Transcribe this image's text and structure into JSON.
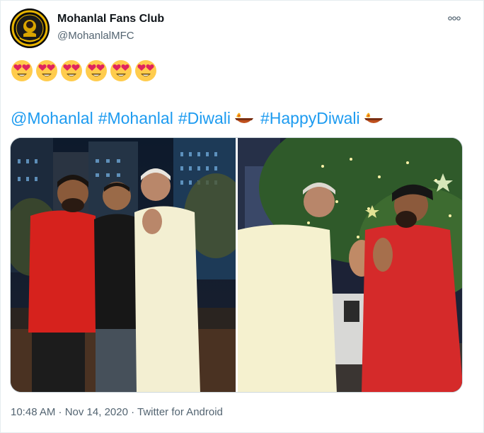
{
  "tweet": {
    "author_name": "Mohanlal Fans Club",
    "author_handle": "@MohanlalMFC",
    "avatar_icon": "club-logo",
    "emoji_line_count": 6,
    "emoji_icon": "heart-eyes-emoji",
    "mention": "@Mohanlal",
    "hashtags": [
      "#Mohanlal",
      "#Diwali",
      "#HappyDiwali"
    ],
    "diya_icon": "diya-lamp-emoji",
    "timestamp": "10:48 AM · Nov 14, 2020",
    "separator": " · ",
    "source": "Twitter for Android",
    "more_icon": "more-options-icon"
  },
  "colors": {
    "link": "#1d9bf0",
    "secondary_text": "#536471",
    "primary_text": "#0f1419",
    "border": "#cfd9de"
  }
}
